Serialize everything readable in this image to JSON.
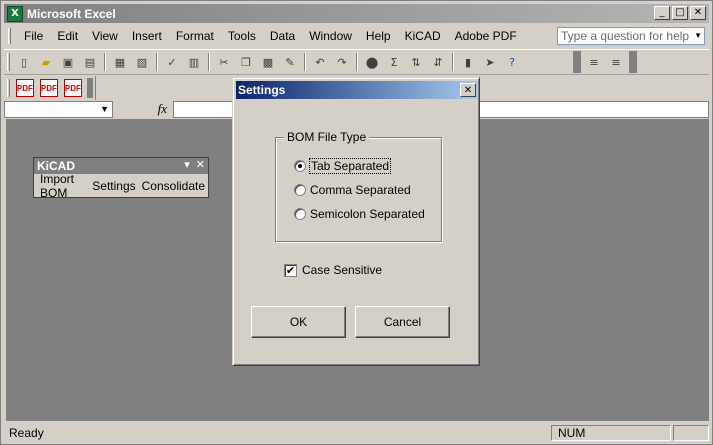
{
  "window": {
    "title": "Microsoft Excel",
    "app_icon": "X",
    "minimize": "_",
    "maximize": "□",
    "close": "✕"
  },
  "menu": [
    "File",
    "Edit",
    "View",
    "Insert",
    "Format",
    "Tools",
    "Data",
    "Window",
    "Help",
    "KiCAD",
    "Adobe PDF"
  ],
  "help_box": {
    "placeholder": "Type a question for help"
  },
  "formula_bar": {
    "fx": "fx"
  },
  "kicad_toolbar": {
    "title": "KiCAD",
    "buttons": [
      "Import BOM",
      "Settings",
      "Consolidate"
    ]
  },
  "status": {
    "ready": "Ready",
    "num": "NUM"
  },
  "dialog": {
    "title": "Settings",
    "close": "✕",
    "group_label": "BOM File Type",
    "options": [
      {
        "label": "Tab Separated",
        "selected": true
      },
      {
        "label": "Comma Separated",
        "selected": false
      },
      {
        "label": "Semicolon Separated",
        "selected": false
      }
    ],
    "case_sensitive": {
      "label": "Case Sensitive",
      "checked": true
    },
    "ok_label": "OK",
    "cancel_label": "Cancel"
  }
}
